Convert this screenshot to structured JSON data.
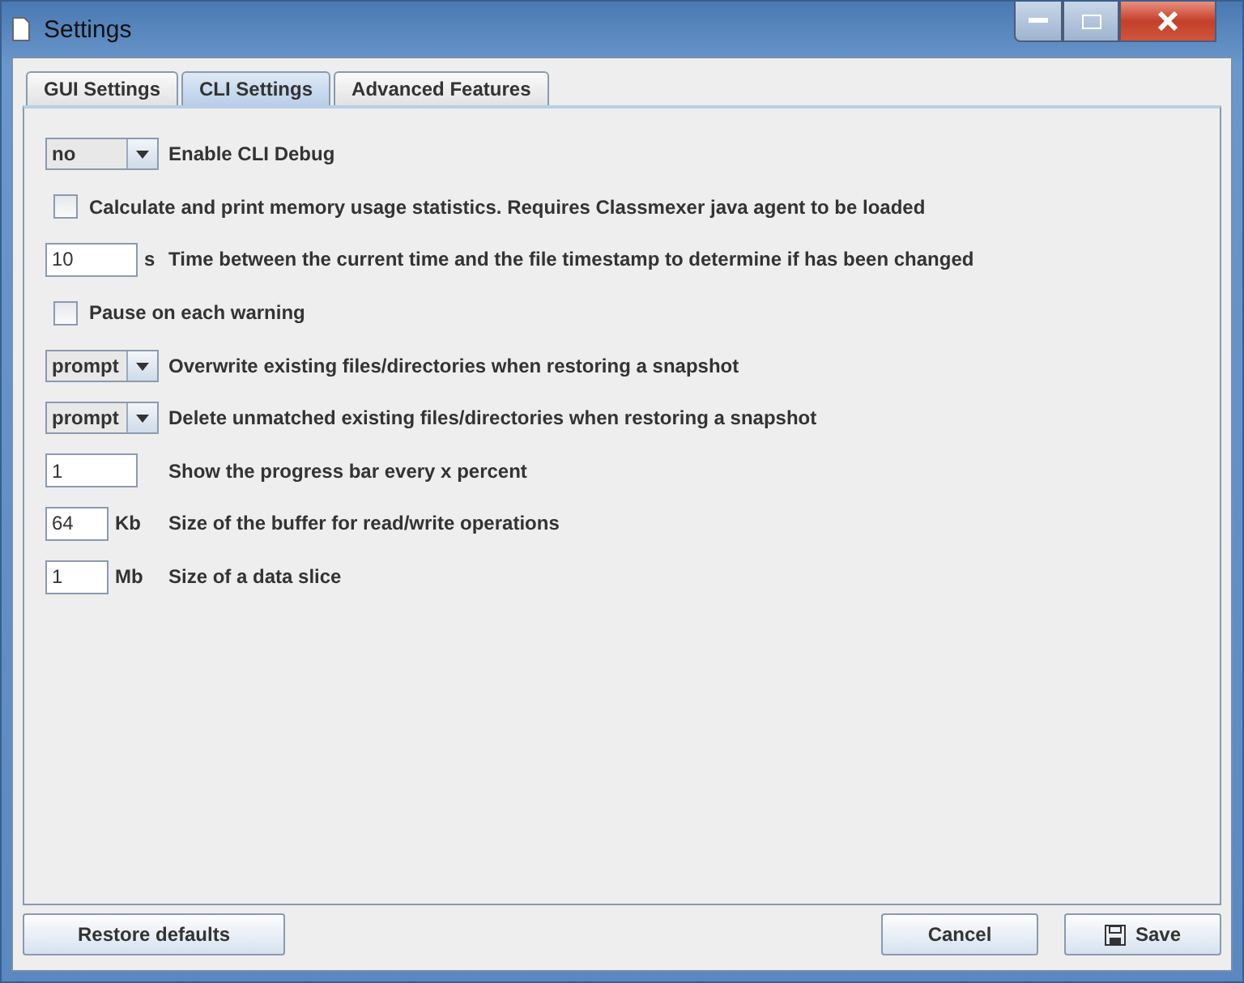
{
  "window": {
    "title": "Settings"
  },
  "tabs": [
    {
      "label": "GUI Settings",
      "selected": false
    },
    {
      "label": "CLI Settings",
      "selected": true
    },
    {
      "label": "Advanced Features",
      "selected": false
    }
  ],
  "rows": [
    {
      "kind": "combo",
      "value": "no",
      "label": "Enable CLI Debug"
    },
    {
      "kind": "checkbox",
      "checked": false,
      "text": "Calculate and print memory usage statistics. Requires Classmexer java agent to be loaded"
    },
    {
      "kind": "text",
      "value": "10",
      "unit": "s",
      "label": "Time between the current time and the file timestamp to determine if has been changed"
    },
    {
      "kind": "checkbox",
      "checked": false,
      "text": "Pause on each warning"
    },
    {
      "kind": "combo",
      "value": "prompt",
      "label": "Overwrite existing files/directories when restoring a snapshot"
    },
    {
      "kind": "combo",
      "value": "prompt",
      "label": "Delete unmatched existing files/directories when restoring a snapshot"
    },
    {
      "kind": "text",
      "value": "1",
      "label": "Show the progress bar every x percent"
    },
    {
      "kind": "text",
      "value": "64",
      "unit": "Kb",
      "label": "Size of the buffer for read/write operations"
    },
    {
      "kind": "text",
      "value": "1",
      "unit": "Mb",
      "label": "Size of a data slice"
    }
  ],
  "buttons": {
    "restore": "Restore defaults",
    "cancel": "Cancel",
    "save": "Save"
  }
}
